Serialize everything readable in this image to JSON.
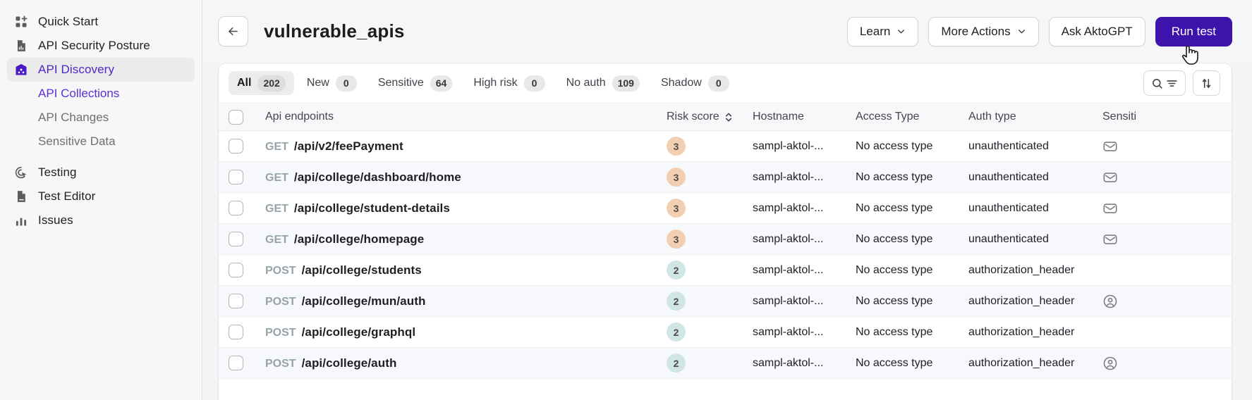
{
  "sidebar": {
    "items": [
      {
        "label": "Quick Start",
        "icon": "grid-plus-icon",
        "active": false,
        "type": "item"
      },
      {
        "label": "API Security Posture",
        "icon": "document-chart-icon",
        "active": false,
        "type": "item"
      },
      {
        "label": "API Discovery",
        "icon": "api-discovery-icon",
        "active": true,
        "type": "item"
      },
      {
        "label": "API Collections",
        "icon": "",
        "active": true,
        "type": "sub"
      },
      {
        "label": "API Changes",
        "icon": "",
        "active": false,
        "type": "sub"
      },
      {
        "label": "Sensitive Data",
        "icon": "",
        "active": false,
        "type": "sub"
      },
      {
        "label": "Testing",
        "icon": "target-cursor-icon",
        "active": false,
        "type": "item"
      },
      {
        "label": "Test Editor",
        "icon": "document-icon",
        "active": false,
        "type": "item"
      },
      {
        "label": "Issues",
        "icon": "bar-chart-icon",
        "active": false,
        "type": "item"
      }
    ]
  },
  "header": {
    "back_icon": "arrow-left-icon",
    "title": "vulnerable_apis",
    "buttons": [
      {
        "label": "Learn",
        "caret": true,
        "primary": false
      },
      {
        "label": "More Actions",
        "caret": true,
        "primary": false
      },
      {
        "label": "Ask AktoGPT",
        "caret": false,
        "primary": false
      },
      {
        "label": "Run test",
        "caret": false,
        "primary": true
      }
    ]
  },
  "filters": {
    "tabs": [
      {
        "label": "All",
        "count": "202",
        "selected": true
      },
      {
        "label": "New",
        "count": "0",
        "selected": false
      },
      {
        "label": "Sensitive",
        "count": "64",
        "selected": false
      },
      {
        "label": "High risk",
        "count": "0",
        "selected": false
      },
      {
        "label": "No auth",
        "count": "109",
        "selected": false
      },
      {
        "label": "Shadow",
        "count": "0",
        "selected": false
      }
    ],
    "search_icon": "search-icon",
    "filter_icon": "filter-lines-icon",
    "sort_icon": "sort-arrows-icon"
  },
  "table": {
    "columns": {
      "endpoints": "Api endpoints",
      "risk": "Risk score",
      "risk_sort_icon": "sort-chevrons-icon",
      "hostname": "Hostname",
      "access": "Access Type",
      "auth": "Auth type",
      "sensitive": "Sensiti"
    },
    "rows": [
      {
        "method": "GET",
        "path": "/api/v2/feePayment",
        "risk": "3",
        "hostname": "sampl-aktol-...",
        "access": "No access type",
        "auth": "unauthenticated",
        "sensitive_icon": "email-icon"
      },
      {
        "method": "GET",
        "path": "/api/college/dashboard/home",
        "risk": "3",
        "hostname": "sampl-aktol-...",
        "access": "No access type",
        "auth": "unauthenticated",
        "sensitive_icon": "email-icon"
      },
      {
        "method": "GET",
        "path": "/api/college/student-details",
        "risk": "3",
        "hostname": "sampl-aktol-...",
        "access": "No access type",
        "auth": "unauthenticated",
        "sensitive_icon": "email-icon"
      },
      {
        "method": "GET",
        "path": "/api/college/homepage",
        "risk": "3",
        "hostname": "sampl-aktol-...",
        "access": "No access type",
        "auth": "unauthenticated",
        "sensitive_icon": "email-icon"
      },
      {
        "method": "POST",
        "path": "/api/college/students",
        "risk": "2",
        "hostname": "sampl-aktol-...",
        "access": "No access type",
        "auth": "authorization_header",
        "sensitive_icon": ""
      },
      {
        "method": "POST",
        "path": "/api/college/mun/auth",
        "risk": "2",
        "hostname": "sampl-aktol-...",
        "access": "No access type",
        "auth": "authorization_header",
        "sensitive_icon": "user-icon"
      },
      {
        "method": "POST",
        "path": "/api/college/graphql",
        "risk": "2",
        "hostname": "sampl-aktol-...",
        "access": "No access type",
        "auth": "authorization_header",
        "sensitive_icon": ""
      },
      {
        "method": "POST",
        "path": "/api/college/auth",
        "risk": "2",
        "hostname": "sampl-aktol-...",
        "access": "No access type",
        "auth": "authorization_header",
        "sensitive_icon": "user-icon"
      }
    ]
  },
  "colors": {
    "accent": "#3d13ab",
    "accent_text": "#4f27c9",
    "risk_high": "#f3cfb2",
    "risk_med": "#cfe5e6",
    "method": "#95a3ab"
  }
}
